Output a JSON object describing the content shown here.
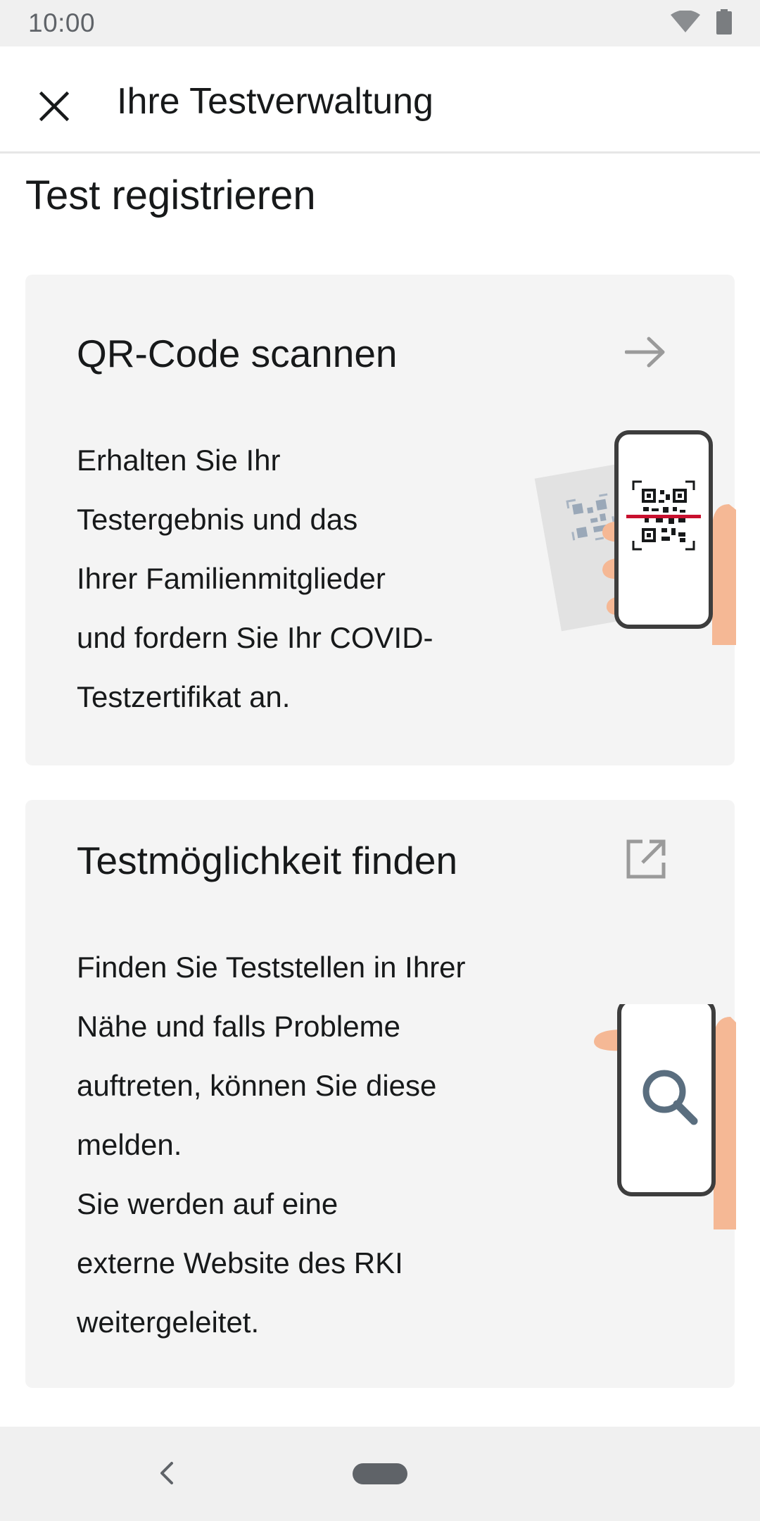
{
  "status_bar": {
    "time": "10:00",
    "icons": [
      "wifi-icon",
      "battery-icon"
    ]
  },
  "toolbar": {
    "close_icon": "close-icon",
    "title": "Ihre Testverwaltung"
  },
  "section": {
    "title": "Test registrieren"
  },
  "cards": [
    {
      "title": "QR-Code scannen",
      "action_icon": "arrow-right-icon",
      "body": "Erhalten Sie Ihr\nTestergebnis und das\nIhrer Familienmitglieder\nund fordern Sie Ihr COVID-\nTestzertifikat an.",
      "illustration": "phone-scanning-qr-illustration"
    },
    {
      "title": "Testmöglichkeit finden",
      "action_icon": "external-link-icon",
      "body": "Finden Sie Teststellen in Ihrer\nNähe und falls Probleme\nauftreten, können Sie diese\nmelden.\nSie werden auf eine\nexterne Website des RKI\nweitergeleitet.",
      "illustration": "phone-search-illustration"
    }
  ],
  "colors": {
    "card_background": "#f4f4f4",
    "text": "#17191a",
    "icon_gray": "#9a9a9a",
    "hand_skin": "#f5b895",
    "scan_line": "#c8102e",
    "search_icon": "#5a6e7f"
  }
}
